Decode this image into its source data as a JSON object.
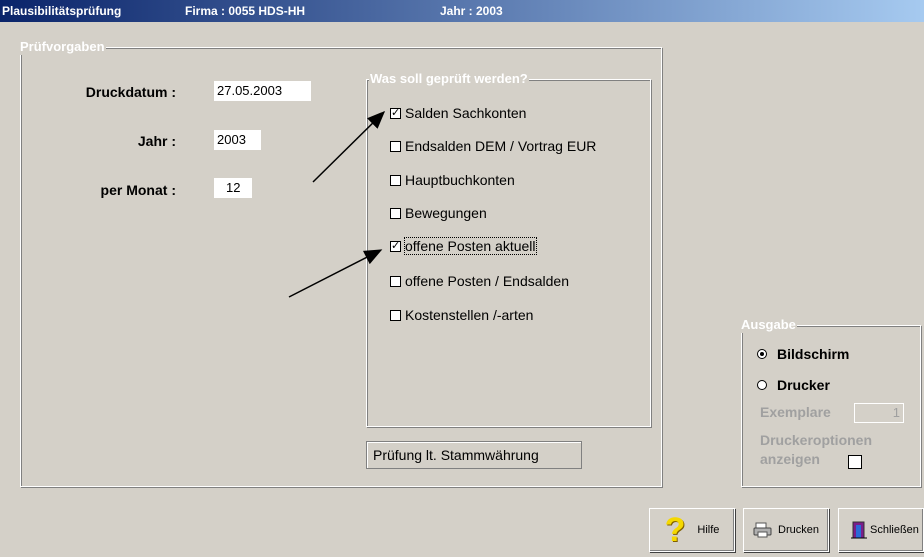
{
  "titlebar": {
    "app": "Plausibilitätsprüfung",
    "firma": "Firma : 0055  HDS-HH",
    "jahr": "Jahr : 2003"
  },
  "pruefvorgaben": {
    "legend": "Prüfvorgaben",
    "druckdatum_label": "Druckdatum :",
    "druckdatum_value": "27.05.2003",
    "jahr_label": "Jahr :",
    "jahr_value": "2003",
    "monat_label": "per Monat :",
    "monat_value": "12"
  },
  "checks": {
    "legend": "Was soll geprüft werden?",
    "items": [
      {
        "label": "Salden Sachkonten",
        "checked": true
      },
      {
        "label": "Endsalden DEM / Vortrag EUR",
        "checked": false
      },
      {
        "label": "Hauptbuchkonten",
        "checked": false
      },
      {
        "label": "Bewegungen",
        "checked": false
      },
      {
        "label": "offene Posten aktuell",
        "checked": true
      },
      {
        "label": "offene Posten / Endsalden",
        "checked": false
      },
      {
        "label": "Kostenstellen /-arten",
        "checked": false
      }
    ],
    "stammwaehrung_button": "Prüfung lt. Stammwährung"
  },
  "ausgabe": {
    "legend": "Ausgabe",
    "bildschirm": "Bildschirm",
    "drucker": "Drucker",
    "selected": "Bildschirm",
    "exemplare_label": "Exemplare",
    "exemplare_value": "1",
    "druckeroptionen_line1": "Druckeroptionen",
    "druckeroptionen_line2": "anzeigen"
  },
  "buttons": {
    "hilfe": "Hilfe",
    "drucken": "Drucken",
    "schliessen": "Schließen"
  },
  "colors": {
    "window_bg": "#d4d0c8",
    "title_start": "#0a246a",
    "title_end": "#a6caf0"
  }
}
